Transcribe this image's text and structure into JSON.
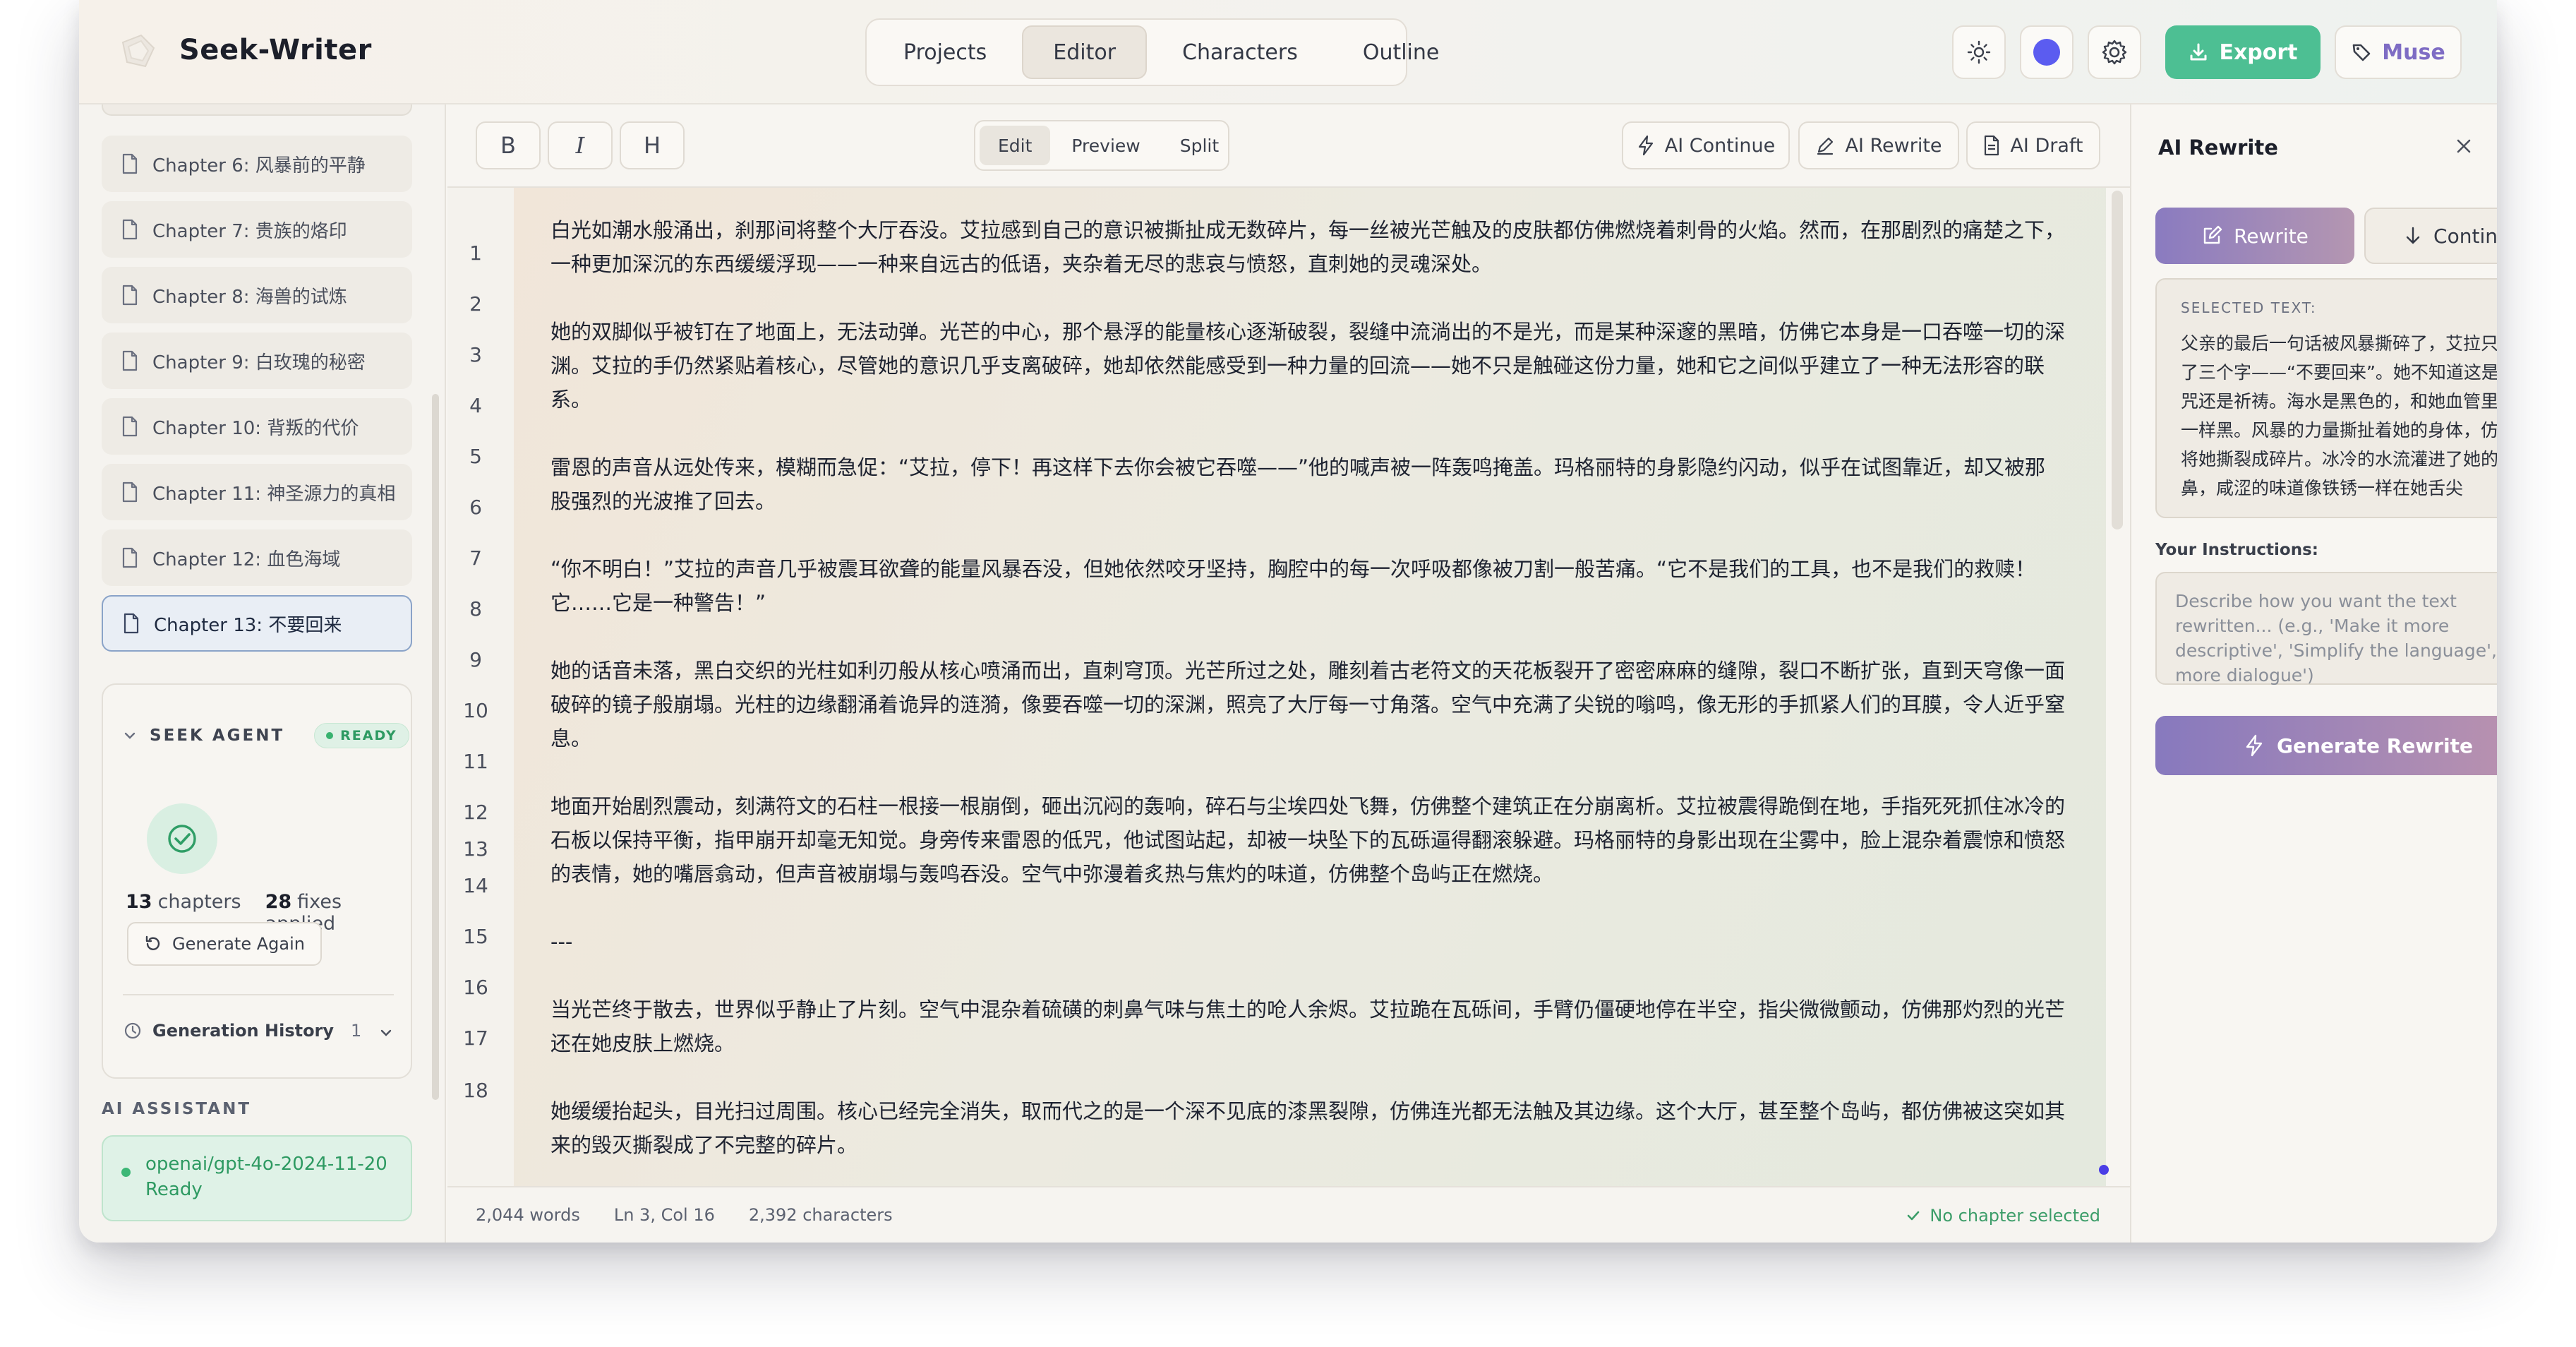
{
  "header": {
    "app_title": "Seek-Writer",
    "nav_tabs": [
      "Projects",
      "Editor",
      "Characters",
      "Outline"
    ],
    "active_tab": "Editor",
    "export_label": "Export",
    "muse_label": "Muse",
    "accent_color": "#4dbf93",
    "icons": [
      "logo-icon",
      "sun-icon",
      "theme-color-dot",
      "gear-icon",
      "download-icon",
      "tag-icon"
    ]
  },
  "sidebar": {
    "chapters": [
      "Chapter 6: 风暴前的平静",
      "Chapter 7: 贵族的烙印",
      "Chapter 8: 海兽的试炼",
      "Chapter 9: 白玫瑰的秘密",
      "Chapter 10: 背叛的代价",
      "Chapter 11: 神圣源力的真相",
      "Chapter 12: 血色海域",
      "Chapter 13: 不要回来"
    ],
    "active_chapter": "Chapter 13: 不要回来",
    "agent": {
      "title": "SEEK AGENT",
      "status": "READY",
      "chapters_count": "13",
      "chapters_label": "chapters",
      "fixes_count": "28",
      "fixes_label": "fixes applied",
      "generate_again": "Generate Again",
      "history_label": "Generation History",
      "history_count": "1"
    },
    "ai_assistant": {
      "label": "AI ASSISTANT",
      "model": "openai/gpt-4o-2024-11-20",
      "status": "Ready"
    }
  },
  "editor": {
    "format_buttons": [
      "B",
      "I",
      "H"
    ],
    "modes": [
      "Edit",
      "Preview",
      "Split"
    ],
    "active_mode": "Edit",
    "ai_tools": [
      "AI Continue",
      "AI Rewrite",
      "AI Draft"
    ],
    "line_numbers": [
      "1",
      "2",
      "3",
      "4",
      "5",
      "6",
      "7",
      "8",
      "9",
      "10",
      "11",
      "12",
      "13",
      "14",
      "15",
      "16",
      "17",
      "18"
    ],
    "paragraphs": [
      "白光如潮水般涌出，刹那间将整个大厅吞没。艾拉感到自己的意识被撕扯成无数碎片，每一丝被光芒触及的皮肤都仿佛燃烧着刺骨的火焰。然而，在那剧烈的痛楚之下，一种更加深沉的东西缓缓浮现——一种来自远古的低语，夹杂着无尽的悲哀与愤怒，直刺她的灵魂深处。",
      "她的双脚似乎被钉在了地面上，无法动弹。光芒的中心，那个悬浮的能量核心逐渐破裂，裂缝中流淌出的不是光，而是某种深邃的黑暗，仿佛它本身是一口吞噬一切的深渊。艾拉的手仍然紧贴着核心，尽管她的意识几乎支离破碎，她却依然能感受到一种力量的回流——她不只是触碰这份力量，她和它之间似乎建立了一种无法形容的联系。",
      "雷恩的声音从远处传来，模糊而急促：“艾拉，停下！再这样下去你会被它吞噬——”他的喊声被一阵轰鸣掩盖。玛格丽特的身影隐约闪动，似乎在试图靠近，却又被那股强烈的光波推了回去。",
      "“你不明白！”艾拉的声音几乎被震耳欲聋的能量风暴吞没，但她依然咬牙坚持，胸腔中的每一次呼吸都像被刀割一般苦痛。“它不是我们的工具，也不是我们的救赎！它……它是一种警告！”",
      "她的话音未落，黑白交织的光柱如利刃般从核心喷涌而出，直刺穹顶。光芒所过之处，雕刻着古老符文的天花板裂开了密密麻麻的缝隙，裂口不断扩张，直到天穹像一面破碎的镜子般崩塌。光柱的边缘翻涌着诡异的涟漪，像要吞噬一切的深渊，照亮了大厅每一寸角落。空气中充满了尖锐的嗡鸣，像无形的手抓紧人们的耳膜，令人近乎窒息。",
      "地面开始剧烈震动，刻满符文的石柱一根接一根崩倒，砸出沉闷的轰响，碎石与尘埃四处飞舞，仿佛整个建筑正在分崩离析。艾拉被震得跪倒在地，手指死死抓住冰冷的石板以保持平衡，指甲崩开却毫无知觉。身旁传来雷恩的低咒，他试图站起，却被一块坠下的瓦砾逼得翻滚躲避。玛格丽特的身影出现在尘雾中，脸上混杂着震惊和愤怒的表情，她的嘴唇翕动，但声音被崩塌与轰鸣吞没。空气中弥漫着炙热与焦灼的味道，仿佛整个岛屿正在燃烧。",
      "---",
      "当光芒终于散去，世界似乎静止了片刻。空气中混杂着硫磺的刺鼻气味与焦土的呛人余烬。艾拉跪在瓦砾间，手臂仍僵硬地停在半空，指尖微微颤动，仿佛那灼烈的光芒还在她皮肤上燃烧。",
      "她缓缓抬起头，目光扫过周围。核心已经完全消失，取而代之的是一个深不见底的漆黑裂隙，仿佛连光都无法触及其边缘。这个大厅，甚至整个岛屿，都仿佛被这突如其来的毁灭撕裂成了不完整的碎片。"
    ],
    "status": {
      "words": "2,044 words",
      "position": "Ln 3, Col 16",
      "characters": "2,392 characters",
      "chapter_state": "No chapter selected"
    }
  },
  "panel": {
    "title": "AI Rewrite",
    "modes": [
      "Rewrite",
      "Continue"
    ],
    "active_mode": "Rewrite",
    "selected_label": "SELECTED TEXT:",
    "selected_text": "父亲的最后一句话被风暴撕碎了，艾拉只听清了三个字——“不要回来”。她不知道这是诅咒还是祈祷。海水是黑色的，和她血管里流的一样黑。风暴的力量撕扯着她的身体，仿佛要将她撕裂成碎片。冰冷的水流灌进了她的口鼻，咸涩的味道像铁锈一样在她舌尖",
    "instructions_label": "Your Instructions:",
    "instructions_placeholder": "Describe how you want the text rewritten... (e.g., 'Make it more descriptive', 'Simplify the language', 'Add more dialogue')",
    "generate_label": "Generate Rewrite"
  }
}
